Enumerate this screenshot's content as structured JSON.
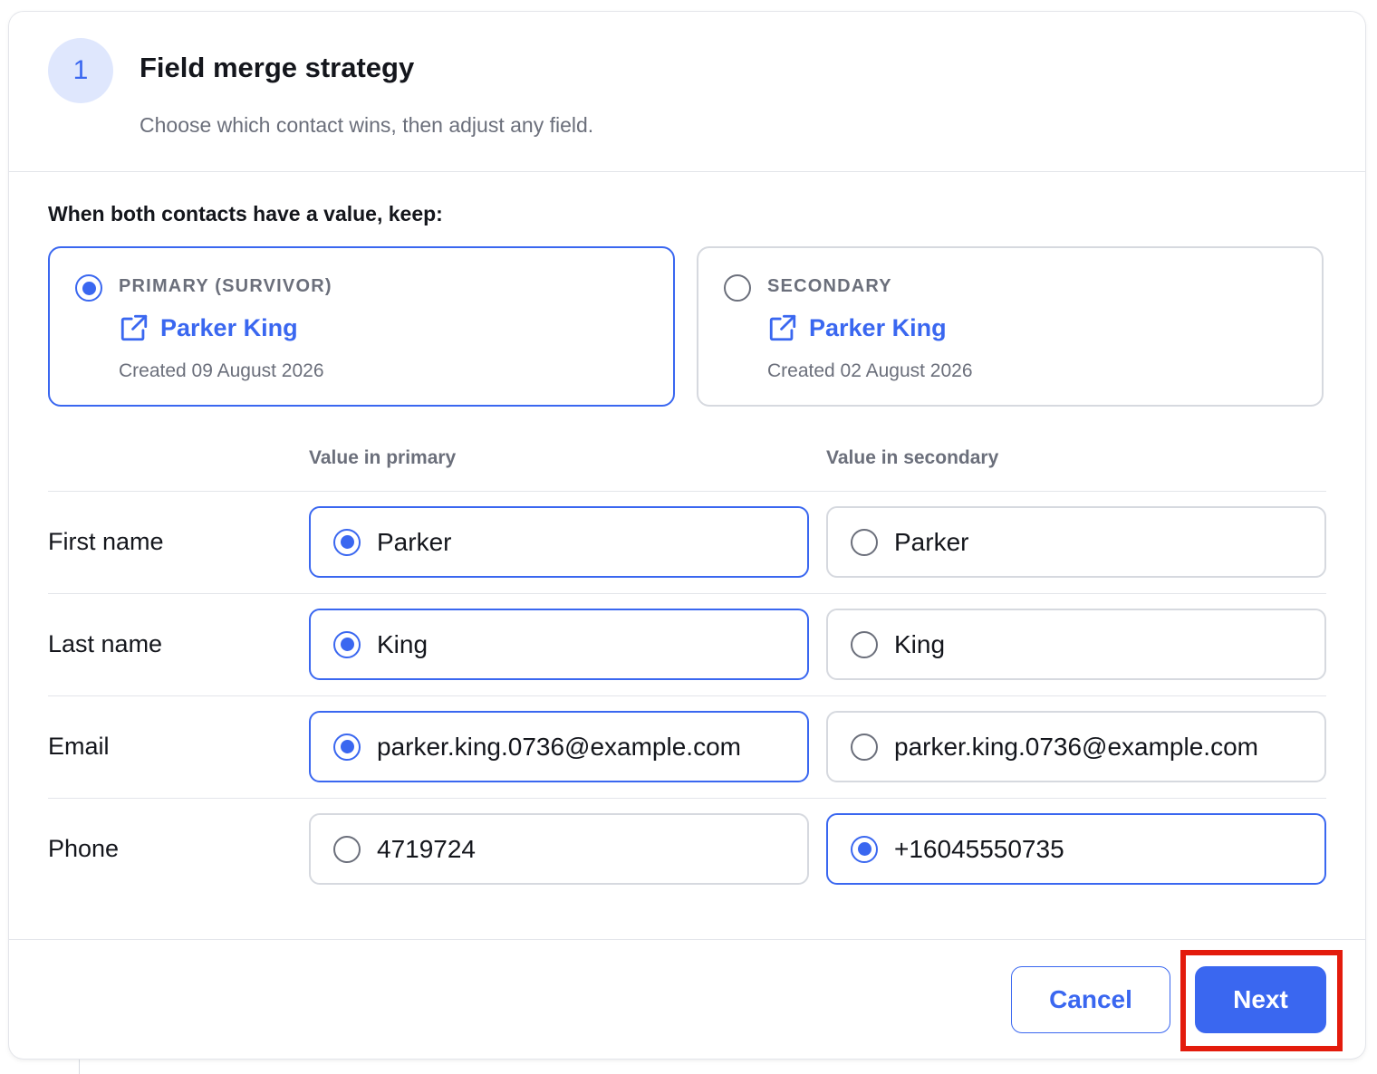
{
  "header": {
    "step_number": "1",
    "title": "Field merge strategy",
    "subtitle": "Choose which contact wins, then adjust any field."
  },
  "strategy": {
    "keep_label": "When both contacts have a value, keep:",
    "primary": {
      "role": "PRIMARY (SURVIVOR)",
      "name": "Parker King",
      "created": "Created 09 August 2026",
      "selected": true
    },
    "secondary": {
      "role": "SECONDARY",
      "name": "Parker King",
      "created": "Created 02 August 2026",
      "selected": false
    }
  },
  "columns": {
    "primary": "Value in primary",
    "secondary": "Value in secondary"
  },
  "fields": [
    {
      "label": "First name",
      "primary": "Parker",
      "secondary": "Parker",
      "selected": "primary"
    },
    {
      "label": "Last name",
      "primary": "King",
      "secondary": "King",
      "selected": "primary"
    },
    {
      "label": "Email",
      "primary": "parker.king.0736@example.com",
      "secondary": "parker.king.0736@example.com",
      "selected": "primary"
    },
    {
      "label": "Phone",
      "primary": "4719724",
      "secondary": "+16045550735",
      "selected": "secondary"
    }
  ],
  "footer": {
    "cancel_label": "Cancel",
    "next_label": "Next"
  },
  "colors": {
    "accent": "#3a67f0",
    "highlight": "#e31b0c"
  }
}
